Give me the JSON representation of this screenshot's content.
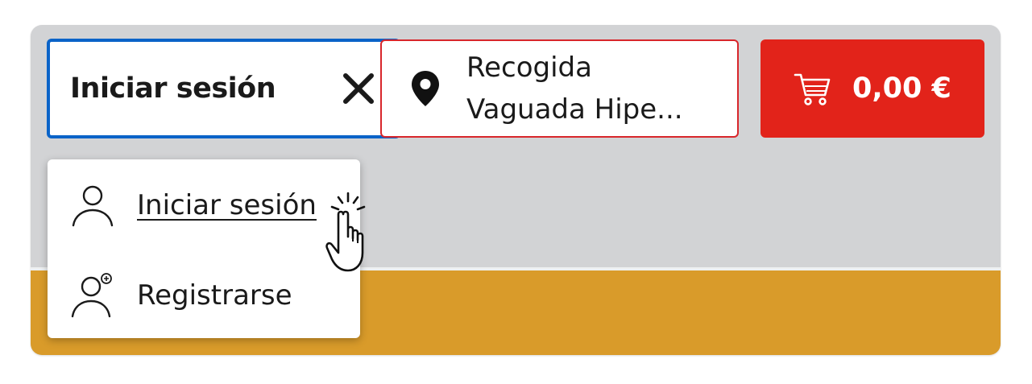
{
  "header": {
    "login_button": {
      "label": "Iniciar sesión",
      "close_icon": "close-icon"
    },
    "pickup_button": {
      "line1": "Recogida",
      "line2": "Vaguada Hipe...",
      "icon": "map-pin-icon"
    },
    "cart_button": {
      "total": "0,00 €",
      "icon": "shopping-cart-icon"
    }
  },
  "dropdown": {
    "items": [
      {
        "label": "Iniciar sesión",
        "icon": "user-icon"
      },
      {
        "label": "Registrarse",
        "icon": "user-add-icon"
      }
    ]
  },
  "colors": {
    "focus_border": "#0a63c8",
    "pickup_border": "#d8262b",
    "cart_background": "#e2231a",
    "header_background": "#d2d3d5",
    "band_background": "#d99b2a"
  }
}
